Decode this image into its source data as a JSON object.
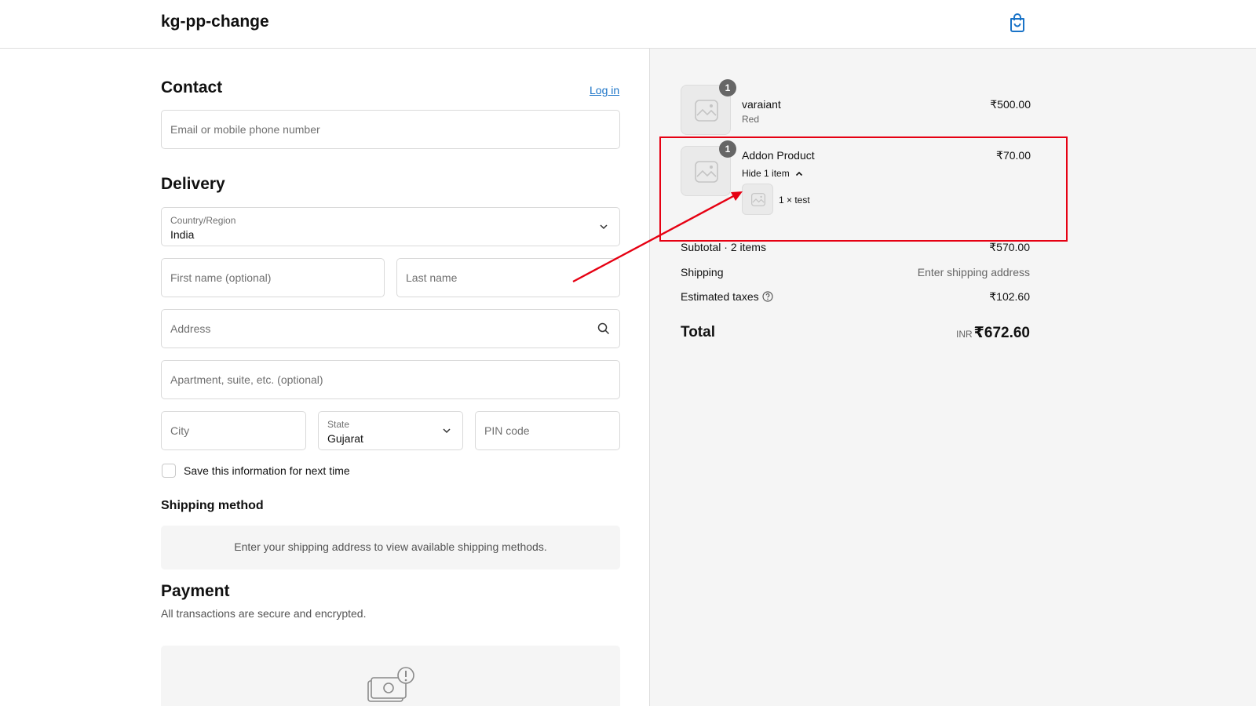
{
  "header": {
    "store_name": "kg-pp-change",
    "cart_icon": "shopping-bag-icon"
  },
  "contact": {
    "title": "Contact",
    "login_label": "Log in",
    "email_placeholder": "Email or mobile phone number"
  },
  "delivery": {
    "title": "Delivery",
    "country_label": "Country/Region",
    "country_value": "India",
    "first_name_placeholder": "First name (optional)",
    "last_name_placeholder": "Last name",
    "address_placeholder": "Address",
    "apartment_placeholder": "Apartment, suite, etc. (optional)",
    "city_placeholder": "City",
    "state_label": "State",
    "state_value": "Gujarat",
    "pin_placeholder": "PIN code",
    "save_info_label": "Save this information for next time"
  },
  "shipping_method": {
    "title": "Shipping method",
    "message": "Enter your shipping address to view available shipping methods."
  },
  "payment": {
    "title": "Payment",
    "subtitle": "All transactions are secure and encrypted.",
    "icon": "cash-warning-icon"
  },
  "order": {
    "items": [
      {
        "qty": "1",
        "name": "varaiant",
        "variant": "Red",
        "price": "₹500.00"
      },
      {
        "qty": "1",
        "name": "Addon Product",
        "toggle_label": "Hide 1 item",
        "price": "₹70.00",
        "sub_items": [
          {
            "label": "1 × test"
          }
        ]
      }
    ],
    "subtotal_label": "Subtotal · 2 items",
    "subtotal_value": "₹570.00",
    "shipping_label": "Shipping",
    "shipping_value": "Enter shipping address",
    "taxes_label": "Estimated taxes",
    "taxes_value": "₹102.60",
    "total_label": "Total",
    "total_currency": "INR",
    "total_value": "₹672.60"
  },
  "colors": {
    "accent": "#1a73c7",
    "annotation": "#e60012",
    "summary_bg": "#f5f5f5"
  }
}
